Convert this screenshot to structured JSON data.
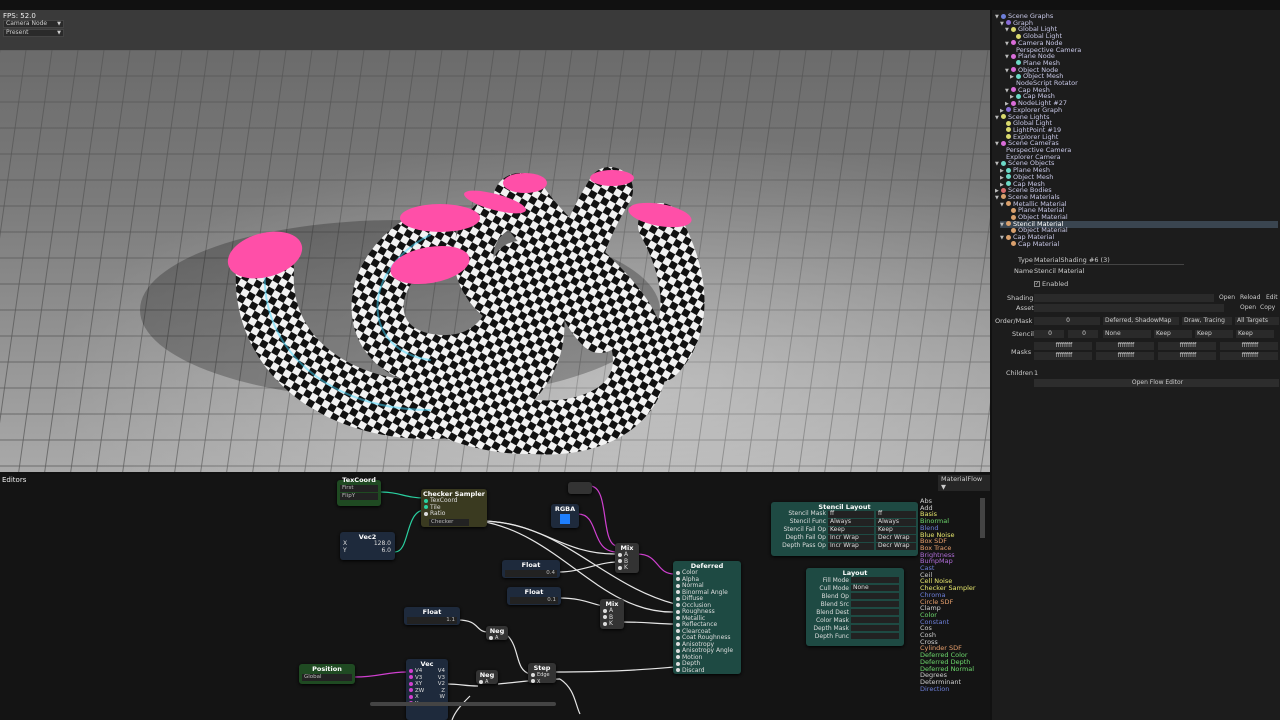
{
  "hud": {
    "fps": "FPS: 52.0",
    "camera_select": "Camera Node",
    "mode_select": "Present"
  },
  "colors": {
    "accent_pink": "#ff4fa8",
    "checker_dark": "#111111",
    "checker_light": "#f2f2f2",
    "rim_cyan": "#3fd8ff",
    "node_teal": "#1e4a43",
    "node_navy": "#1e2a3c",
    "node_green": "#1f4a22"
  },
  "tree": [
    {
      "label": "Scene Graphs",
      "indent": 0,
      "arrow": "▼",
      "icon": "#6d7fd9"
    },
    {
      "label": "Graph",
      "indent": 1,
      "arrow": "▼",
      "icon": "#8a6dd9"
    },
    {
      "label": "Global Light",
      "indent": 2,
      "arrow": "▼",
      "icon": "#d9d96d"
    },
    {
      "label": "Global Light",
      "indent": 3,
      "arrow": "",
      "icon": "#d9d96d"
    },
    {
      "label": "Camera Node",
      "indent": 2,
      "arrow": "▼",
      "icon": "#d96dd9"
    },
    {
      "label": "Perspective Camera",
      "indent": 3,
      "arrow": "",
      "icon": ""
    },
    {
      "label": "Plane Node",
      "indent": 2,
      "arrow": "▼",
      "icon": "#d96dd9"
    },
    {
      "label": "Plane Mesh",
      "indent": 3,
      "arrow": "",
      "icon": "#6dd9c7"
    },
    {
      "label": "Object Node",
      "indent": 2,
      "arrow": "▼",
      "icon": "#d96dd9"
    },
    {
      "label": "Object Mesh",
      "indent": 3,
      "arrow": "▶",
      "icon": "#6dd9c7"
    },
    {
      "label": "NodeScript Rotator",
      "indent": 3,
      "arrow": "",
      "icon": ""
    },
    {
      "label": "Cap Mesh",
      "indent": 2,
      "arrow": "▼",
      "icon": "#d96dd9"
    },
    {
      "label": "Cap Mesh",
      "indent": 3,
      "arrow": "▶",
      "icon": "#6dd9c7"
    },
    {
      "label": "NodeLight #27",
      "indent": 2,
      "arrow": "▶",
      "icon": "#d96dd9"
    },
    {
      "label": "Explorer Graph",
      "indent": 1,
      "arrow": "▶",
      "icon": "#8a6dd9"
    },
    {
      "label": "Scene Lights",
      "indent": 0,
      "arrow": "▼",
      "icon": "#d9d96d"
    },
    {
      "label": "Global Light",
      "indent": 1,
      "arrow": "",
      "icon": "#d9d96d"
    },
    {
      "label": "LightPoint #19",
      "indent": 1,
      "arrow": "",
      "icon": "#d9d96d"
    },
    {
      "label": "Explorer Light",
      "indent": 1,
      "arrow": "",
      "icon": "#d9d96d"
    },
    {
      "label": "Scene Cameras",
      "indent": 0,
      "arrow": "▼",
      "icon": "#d96dd9"
    },
    {
      "label": "Perspective Camera",
      "indent": 1,
      "arrow": "",
      "icon": ""
    },
    {
      "label": "Explorer Camera",
      "indent": 1,
      "arrow": "",
      "icon": ""
    },
    {
      "label": "Scene Objects",
      "indent": 0,
      "arrow": "▼",
      "icon": "#6dd9c7"
    },
    {
      "label": "Plane Mesh",
      "indent": 1,
      "arrow": "▶",
      "icon": "#6dd9c7"
    },
    {
      "label": "Object Mesh",
      "indent": 1,
      "arrow": "▶",
      "icon": "#6dd9c7"
    },
    {
      "label": "Cap Mesh",
      "indent": 1,
      "arrow": "▶",
      "icon": "#6dd9c7"
    },
    {
      "label": "Scene Bodies",
      "indent": 0,
      "arrow": "▶",
      "icon": "#d96d6d"
    },
    {
      "label": "Scene Materials",
      "indent": 0,
      "arrow": "▼",
      "icon": "#d9a06d"
    },
    {
      "label": "Metallic Material",
      "indent": 1,
      "arrow": "▼",
      "icon": "#d9a06d"
    },
    {
      "label": "Plane Material",
      "indent": 2,
      "arrow": "",
      "icon": "#d9a06d"
    },
    {
      "label": "Object Material",
      "indent": 2,
      "arrow": "",
      "icon": "#d9a06d"
    },
    {
      "label": "Stencil Material",
      "indent": 1,
      "arrow": "▼",
      "icon": "#d9a06d",
      "selected": true
    },
    {
      "label": "Object Material",
      "indent": 2,
      "arrow": "",
      "icon": "#d9a06d"
    },
    {
      "label": "Cap Material",
      "indent": 1,
      "arrow": "▼",
      "icon": "#d9a06d"
    },
    {
      "label": "Cap Material",
      "indent": 2,
      "arrow": "",
      "icon": "#d9a06d"
    }
  ],
  "props": {
    "type_label": "Type",
    "type_value": "MaterialShading #6 (3)",
    "name_label": "Name",
    "name_value": "Stencil Material",
    "enabled_label": "Enabled",
    "shading_label": "Shading",
    "shading_open": "Open",
    "shading_reload": "Reload",
    "shading_edit": "Edit",
    "asset_label": "Asset",
    "asset_open": "Open",
    "asset_copy": "Copy",
    "order_label": "Order/Mask",
    "order_value": "0",
    "order_mode": "Deferred, ShadowMap",
    "order_trace": "Draw, Tracing",
    "order_targets": "All Targets",
    "stencil_label": "Stencil",
    "stencil_a": "0",
    "stencil_b": "0",
    "stencil_func": "None",
    "stencil_k1": "Keep",
    "stencil_k2": "Keep",
    "stencil_k3": "Keep",
    "masks_label": "Masks",
    "mask_value": "ffffffff",
    "children_label": "Children",
    "children_value": "1",
    "open_flow": "Open Flow Editor"
  },
  "editors": {
    "title": "Editors",
    "selector": "MaterialFlow",
    "palette": [
      {
        "label": "Abs",
        "color": "#cfcfcf"
      },
      {
        "label": "Add",
        "color": "#cfcfcf"
      },
      {
        "label": "Basis",
        "color": "#e8e86d"
      },
      {
        "label": "Binormal",
        "color": "#6dd96d"
      },
      {
        "label": "Blend",
        "color": "#6d7fd9"
      },
      {
        "label": "Blue Noise",
        "color": "#e8e86d"
      },
      {
        "label": "Box SDF",
        "color": "#e8a06d"
      },
      {
        "label": "Box Trace",
        "color": "#e8a06d"
      },
      {
        "label": "Brightness",
        "color": "#b06dd9"
      },
      {
        "label": "BumpMap",
        "color": "#b06dd9"
      },
      {
        "label": "Cast",
        "color": "#6d7fd9"
      },
      {
        "label": "Ceil",
        "color": "#cfcfcf"
      },
      {
        "label": "Cell Noise",
        "color": "#e8e86d"
      },
      {
        "label": "Checker Sampler",
        "color": "#e8e86d"
      },
      {
        "label": "Chroma",
        "color": "#6d7fd9"
      },
      {
        "label": "Circle SDF",
        "color": "#e8a06d"
      },
      {
        "label": "Clamp",
        "color": "#cfcfcf"
      },
      {
        "label": "Color",
        "color": "#6dd96d"
      },
      {
        "label": "Constant",
        "color": "#6d7fd9"
      },
      {
        "label": "Cos",
        "color": "#cfcfcf"
      },
      {
        "label": "Cosh",
        "color": "#cfcfcf"
      },
      {
        "label": "Cross",
        "color": "#cfcfcf"
      },
      {
        "label": "Cylinder SDF",
        "color": "#e8a06d"
      },
      {
        "label": "Deferred Color",
        "color": "#6dd96d"
      },
      {
        "label": "Deferred Depth",
        "color": "#6dd96d"
      },
      {
        "label": "Deferred Normal",
        "color": "#6dd96d"
      },
      {
        "label": "Degrees",
        "color": "#cfcfcf"
      },
      {
        "label": "Determinant",
        "color": "#cfcfcf"
      },
      {
        "label": "Direction",
        "color": "#6d7fd9"
      }
    ],
    "nodes": {
      "texcoord": {
        "title": "TexCoord",
        "sel1": "First",
        "sel2": "FlipY"
      },
      "checker": {
        "title": "Checker Sampler",
        "in1": "TexCoord",
        "in2": "Tile",
        "in3": "Ratio",
        "sel": "Checker"
      },
      "vec2": {
        "title": "Vec2",
        "x_label": "X",
        "x_value": "128.0",
        "y_label": "Y",
        "y_value": "6.0"
      },
      "rgba": {
        "title": "RGBA"
      },
      "mix1": {
        "title": "Mix",
        "a": "A",
        "b": "B",
        "k": "K"
      },
      "mix2": {
        "title": "Mix",
        "a": "A",
        "b": "B",
        "k": "K"
      },
      "float1": {
        "title": "Float",
        "value": "0.4"
      },
      "float2": {
        "title": "Float",
        "value": "0.1"
      },
      "float3": {
        "title": "Float",
        "value": "1.1"
      },
      "neg1": {
        "title": "Neg",
        "a": "A"
      },
      "neg2": {
        "title": "Neg",
        "a": "A"
      },
      "step": {
        "title": "Step",
        "edge": "Edge",
        "x": "X"
      },
      "position": {
        "title": "Position",
        "sel": "Global"
      },
      "vec": {
        "title": "Vec",
        "rows": [
          "V4",
          "V3",
          "XY",
          "ZW",
          "X",
          "Y"
        ],
        "rows_r": [
          "V4",
          "V3",
          "V2",
          "Z",
          "W",
          ""
        ]
      },
      "deferred": {
        "title": "Deferred",
        "inputs": [
          "Color",
          "Alpha",
          "Normal",
          "Binormal Angle",
          "Diffuse",
          "Occlusion",
          "Roughness",
          "Metallic",
          "Reflectance",
          "Clearcoat",
          "Coat Roughness",
          "Anisotropy",
          "Anisotropy Angle",
          "Motion",
          "Depth",
          "Discard"
        ]
      },
      "stencil_layout": {
        "title": "Stencil Layout",
        "rows": [
          {
            "label": "Stencil Mask",
            "v1": "ff",
            "v2": "ff"
          },
          {
            "label": "Stencil Func",
            "v1": "Always",
            "v2": "Always"
          },
          {
            "label": "Stencil Fail Op",
            "v1": "Keep",
            "v2": "Keep"
          },
          {
            "label": "Depth Fail Op",
            "v1": "Incr Wrap",
            "v2": "Decr Wrap"
          },
          {
            "label": "Depth Pass Op",
            "v1": "Incr Wrap",
            "v2": "Decr Wrap"
          }
        ]
      },
      "layout": {
        "title": "Layout",
        "rows": [
          {
            "label": "Fill Mode",
            "v": ""
          },
          {
            "label": "Cull Mode",
            "v": "None"
          },
          {
            "label": "Blend Op",
            "v": ""
          },
          {
            "label": "Blend Src",
            "v": ""
          },
          {
            "label": "Blend Dest",
            "v": ""
          },
          {
            "label": "Color Mask",
            "v": ""
          },
          {
            "label": "Depth Mask",
            "v": ""
          },
          {
            "label": "Depth Func",
            "v": ""
          }
        ]
      }
    }
  }
}
